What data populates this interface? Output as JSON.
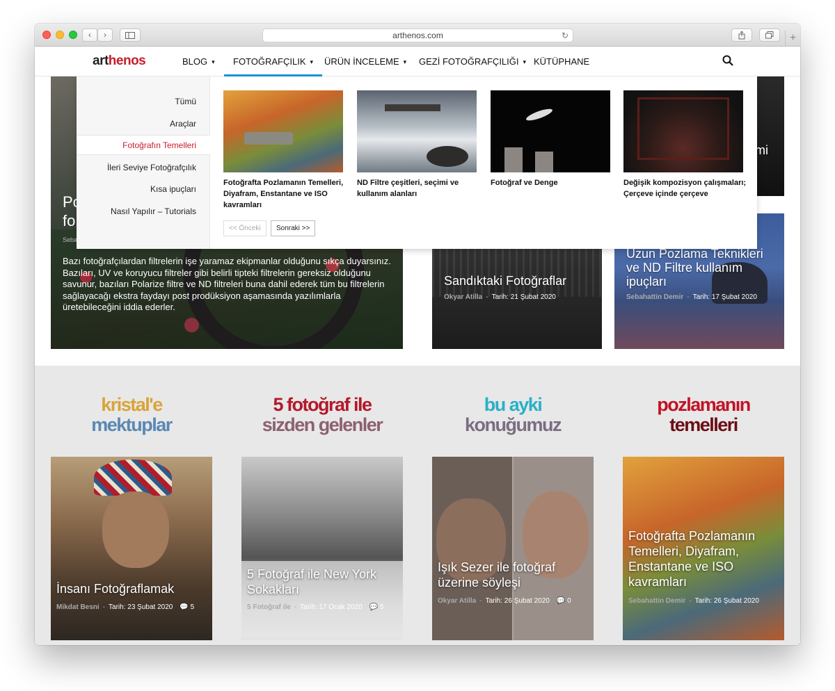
{
  "browser": {
    "url": "arthenos.com"
  },
  "nav": {
    "logo_a": "art",
    "logo_b": "henos",
    "items": [
      {
        "label": "BLOG",
        "has_dropdown": true
      },
      {
        "label": "FOTOĞRAFÇILIK",
        "has_dropdown": true,
        "active": true
      },
      {
        "label": "ÜRÜN İNCELEME",
        "has_dropdown": true
      },
      {
        "label": "GEZİ FOTOĞRAFÇILIĞI",
        "has_dropdown": true
      },
      {
        "label": "KÜTÜPHANE",
        "has_dropdown": false
      }
    ],
    "chevron": "▾"
  },
  "dropdown": {
    "categories": [
      {
        "label": "Tümü"
      },
      {
        "label": "Araçlar"
      },
      {
        "label": "Fotoğrafın Temelleri",
        "active": true
      },
      {
        "label": "İleri Seviye Fotoğrafçılık"
      },
      {
        "label": "Kısa ipuçları"
      },
      {
        "label": "Nasıl Yapılır – Tutorials"
      }
    ],
    "posts": [
      {
        "caption": "Fotoğrafta Pozlamanın Temelleri, Diyafram, Enstantane ve ISO kavramları"
      },
      {
        "caption": "ND Filtre çeşitleri, seçimi ve kullanım alanları"
      },
      {
        "caption": "Fotoğraf ve Denge"
      },
      {
        "caption": "Değişik kompozisyon çalışmaları; Çerçeve içinde çerçeve"
      }
    ],
    "prev_label": "<< Önceki",
    "next_label": "Sonraki >>"
  },
  "hero": {
    "title": "Po\nfo",
    "meta": "Seba",
    "excerpt": "Bazı fotoğrafçılardan filtrelerin işe yaramaz ekipmanlar olduğunu sıkça duyarsınız. Bazıları, UV ve koruyucu filtreler gibi belirli tipteki filtrelerin gereksiz olduğunu savunur, bazıları Polarize filtre ve ND filtreleri buna dahil ederek tüm bu filtrelerin sağlayacağı ekstra faydayı post prodüksiyon aşamasında yazılımlarla üretebileceğini iddia ederler.",
    "partial_right_text": "mi"
  },
  "cards": [
    {
      "title": "Sandıktaki Fotoğraflar",
      "author": "Okyar Atilla",
      "date": "Tarih: 21 Şubat 2020"
    },
    {
      "title": "Uzun Pozlama Teknikleri ve ND Filtre kullanım ipuçları",
      "author": "Sebahattin Demir",
      "date": "Tarih: 17 Şubat 2020"
    }
  ],
  "sections": [
    {
      "line1": "kristal'e",
      "line2": "mektuplar",
      "color_top": "#d9a43a",
      "color_bottom": "#2e7fc4"
    },
    {
      "line1": "5 fotoğraf ile",
      "line2": "sizden gelenler",
      "color_top": "#b3182a",
      "color_bottom": "#6e7f8c"
    },
    {
      "line1": "bu ayki",
      "line2": "konuğumuz",
      "color_top": "#2ab0c8",
      "color_bottom": "#b3182a"
    },
    {
      "line1": "pozlamanın",
      "line2": "temelleri",
      "color_top": "#c01426",
      "color_bottom": "#6b0d16"
    }
  ],
  "bottom_cards": [
    {
      "title": "İnsanı Fotoğraflamak",
      "author": "Mikdat Besni",
      "date": "Tarih: 23 Şubat 2020",
      "comments": "5"
    },
    {
      "title": "5 Fotoğraf ile New York Sokakları",
      "author": "5 Fotoğraf ile",
      "date": "Tarih: 17 Ocak 2020",
      "comments": "5"
    },
    {
      "title": "Işık Sezer ile fotoğraf üzerine söyleşi",
      "author": "Okyar Atilla",
      "date": "Tarih: 26 Şubat 2020",
      "comments": "0"
    },
    {
      "title": "Fotoğrafta Pozlamanın Temelleri, Diyafram, Enstantane ve ISO kavramları",
      "author": "Sebahattin Demir",
      "date": "Tarih: 26 Şubat 2020",
      "comments": ""
    }
  ],
  "meta_sep": "-",
  "comment_icon": "💬"
}
